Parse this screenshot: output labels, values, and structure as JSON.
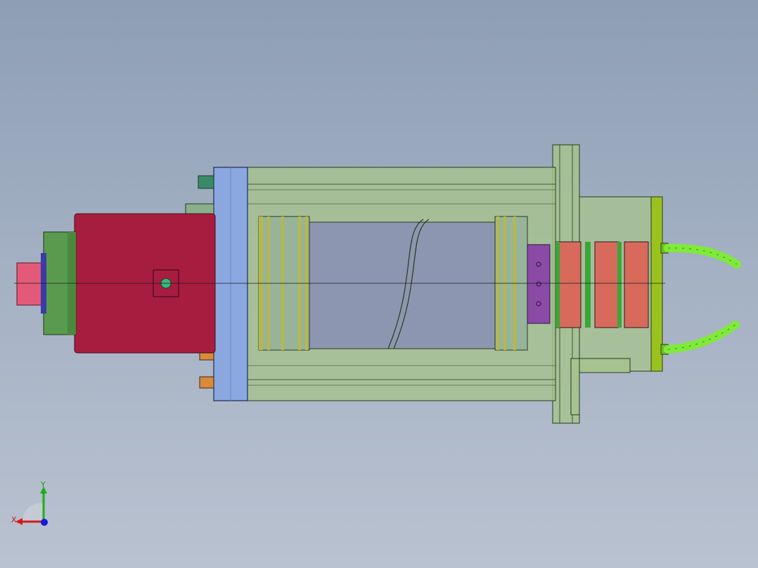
{
  "viewport": {
    "background_top": "#8e9eb5",
    "background_bottom": "#b9c2d0"
  },
  "model": {
    "name_icon": "spindle-assembly-icon",
    "colors": {
      "housing_translucent": "#a6c28f",
      "flange_blue": "#8aa7e0",
      "motor_red": "#a71d3f",
      "green_ring": "#5a9a4e",
      "nose_pink": "#e35a78",
      "rotor_gray": "#8d96b0",
      "purple_hub": "#8a4aa6",
      "salmon_rings": "#d86a5c",
      "end_plate": "#9ac21e",
      "hose_green": "#7fea3a",
      "fitting_orange": "#d98a3a",
      "fitting_teal": "#3a8a6a"
    }
  },
  "triad": {
    "x_label": "X",
    "y_label": "Y",
    "x_color": "#d81818",
    "y_color": "#18b018",
    "z_color": "#1818d8"
  }
}
